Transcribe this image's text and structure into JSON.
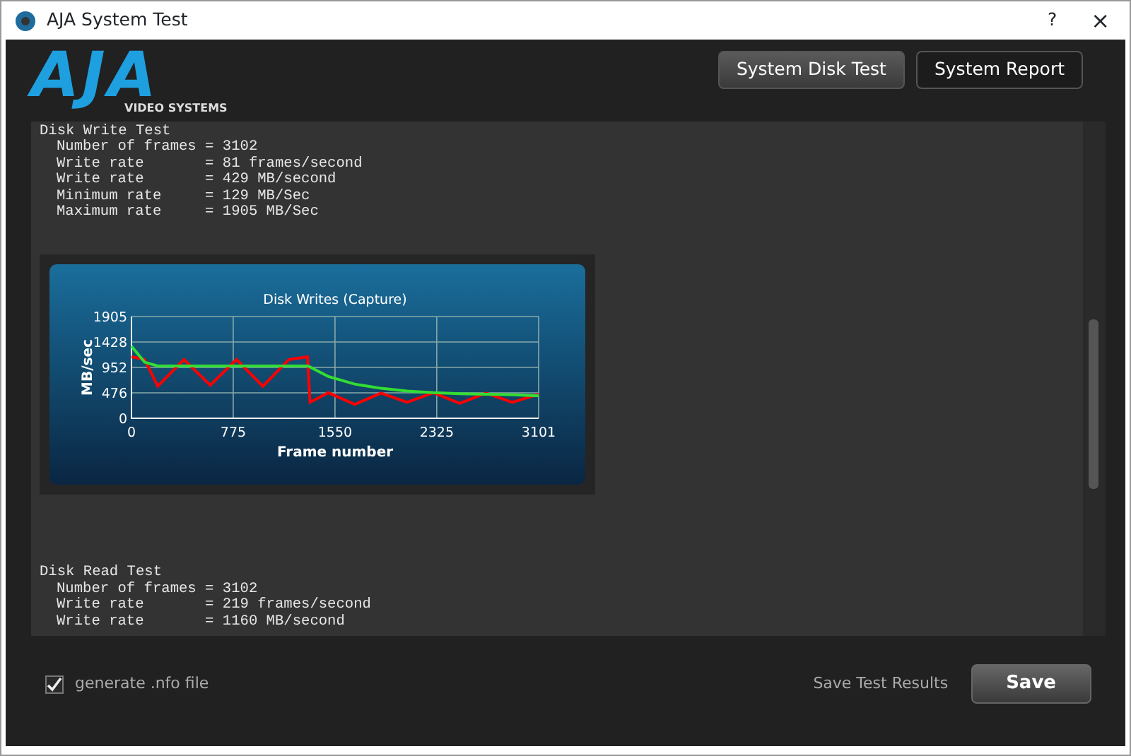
{
  "window": {
    "title": "AJA System Test",
    "help": "?",
    "close": "×"
  },
  "logo": {
    "mark": "AJA",
    "tagline": "VIDEO SYSTEMS"
  },
  "header_buttons": [
    {
      "label": "System Disk Test",
      "selected": true
    },
    {
      "label": "System Report",
      "selected": false
    }
  ],
  "write_test": {
    "title": "Disk Write Test",
    "lines": [
      "Number of frames = 3102",
      "Write rate       = 81 frames/second",
      "Write rate       = 429 MB/second",
      "Minimum rate     = 129 MB/Sec",
      "Maximum rate     = 1905 MB/Sec"
    ],
    "chart_data": {
      "type": "line",
      "title": "Disk Writes (Capture)",
      "xlabel": "Frame number",
      "ylabel": "MB/sec",
      "x": [
        0,
        100,
        200,
        400,
        600,
        800,
        1000,
        1200,
        1340,
        1360,
        1500,
        1700,
        1900,
        2100,
        2300,
        2500,
        2700,
        2900,
        3101
      ],
      "grid": true,
      "xlim": [
        0,
        3101
      ],
      "ylim": [
        0,
        1905
      ],
      "xticks": [
        0,
        775,
        1550,
        2325,
        3101
      ],
      "yticks": [
        0,
        476,
        952,
        1428,
        1905
      ],
      "series": [
        {
          "color": "#ff0000",
          "values": [
            1150,
            1100,
            600,
            1100,
            620,
            1100,
            600,
            1100,
            1150,
            300,
            480,
            260,
            470,
            300,
            480,
            280,
            470,
            300,
            450
          ]
        },
        {
          "color": "#33dd33",
          "values": [
            1350,
            1050,
            980,
            980,
            980,
            980,
            980,
            980,
            980,
            960,
            780,
            640,
            560,
            510,
            480,
            460,
            450,
            440,
            420
          ]
        }
      ]
    }
  },
  "read_test": {
    "title": "Disk Read Test",
    "lines": [
      "Number of frames = 3102",
      "Write rate       = 219 frames/second",
      "Write rate       = 1160 MB/second"
    ]
  },
  "footer": {
    "nfo": {
      "label": "generate .nfo file",
      "checked": true
    },
    "save_label": "Save Test Results",
    "save_button": "Save"
  }
}
